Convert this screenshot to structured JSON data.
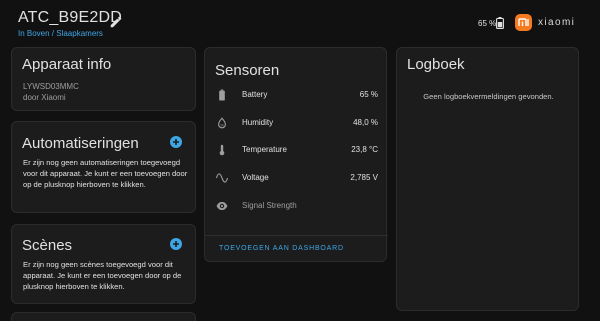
{
  "header": {
    "title": "ATC_B9E2DD",
    "breadcrumb": "In Boven / Slaapkamers",
    "battery_pct": "65 %",
    "brand": "xiaomi",
    "brand_color": "#f57a20"
  },
  "device_info": {
    "title": "Apparaat info",
    "model": "LYWSD03MMC",
    "manufacturer": "door Xiaomi"
  },
  "automations": {
    "title": "Automatiseringen",
    "description": "Er zijn nog geen automatiseringen toegevoegd voor dit apparaat. Je kunt er een toevoegen door op de plusknop hierboven te klikken."
  },
  "scenes": {
    "title": "Scènes",
    "description": "Er zijn nog geen scènes toegevoegd voor dit apparaat. Je kunt er een toevoegen door op de plusknop hierboven te klikken."
  },
  "sensors": {
    "title": "Sensoren",
    "items": [
      {
        "name": "Battery",
        "value": "65 %",
        "icon": "battery-icon"
      },
      {
        "name": "Humidity",
        "value": "48,0 %",
        "icon": "water-drop-icon"
      },
      {
        "name": "Temperature",
        "value": "23,8 °C",
        "icon": "thermometer-icon"
      },
      {
        "name": "Voltage",
        "value": "2,785 V",
        "icon": "sine-wave-icon"
      },
      {
        "name": "Signal Strength",
        "value": "",
        "icon": "eye-icon"
      }
    ],
    "dashboard_link": "TOEVOEGEN AAN DASHBOARD"
  },
  "logbook": {
    "title": "Logboek",
    "empty_text": "Geen logboekvermeldingen gevonden."
  },
  "colors": {
    "accent": "#3fa6e6",
    "background": "#111111",
    "card": "#1c1c1c",
    "icon": "#9e9e9e"
  }
}
